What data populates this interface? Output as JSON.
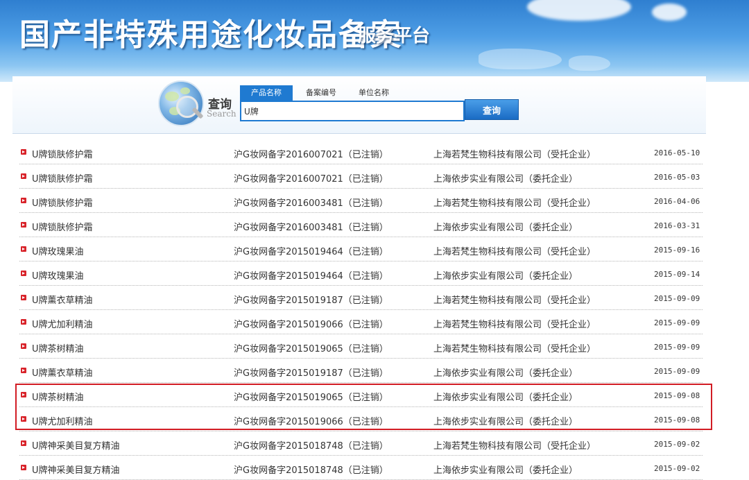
{
  "header": {
    "title": "国产非特殊用途化妆品备案",
    "subtitle": "服务平台"
  },
  "search": {
    "label_cn": "查询",
    "label_en": "Search",
    "tabs": [
      {
        "label": "产品名称",
        "active": true
      },
      {
        "label": "备案编号",
        "active": false
      },
      {
        "label": "单位名称",
        "active": false
      }
    ],
    "input_value": "U牌",
    "button_label": "查询"
  },
  "results": [
    {
      "name": "U牌锁肤修护霜",
      "record_no": "沪G妆网备字2016007021（已注销）",
      "company": "上海若梵生物科技有限公司（受托企业）",
      "date": "2016-05-10"
    },
    {
      "name": "U牌锁肤修护霜",
      "record_no": "沪G妆网备字2016007021（已注销）",
      "company": "上海依步实业有限公司（委托企业）",
      "date": "2016-05-03"
    },
    {
      "name": "U牌锁肤修护霜",
      "record_no": "沪G妆网备字2016003481（已注销）",
      "company": "上海若梵生物科技有限公司（受托企业）",
      "date": "2016-04-06"
    },
    {
      "name": "U牌锁肤修护霜",
      "record_no": "沪G妆网备字2016003481（已注销）",
      "company": "上海依步实业有限公司（委托企业）",
      "date": "2016-03-31"
    },
    {
      "name": "U牌玫瑰果油",
      "record_no": "沪G妆网备字2015019464（已注销）",
      "company": "上海若梵生物科技有限公司（受托企业）",
      "date": "2015-09-16"
    },
    {
      "name": "U牌玫瑰果油",
      "record_no": "沪G妆网备字2015019464（已注销）",
      "company": "上海依步实业有限公司（委托企业）",
      "date": "2015-09-14"
    },
    {
      "name": "U牌薰衣草精油",
      "record_no": "沪G妆网备字2015019187（已注销）",
      "company": "上海若梵生物科技有限公司（受托企业）",
      "date": "2015-09-09"
    },
    {
      "name": "U牌尤加利精油",
      "record_no": "沪G妆网备字2015019066（已注销）",
      "company": "上海若梵生物科技有限公司（受托企业）",
      "date": "2015-09-09"
    },
    {
      "name": "U牌茶树精油",
      "record_no": "沪G妆网备字2015019065（已注销）",
      "company": "上海若梵生物科技有限公司（受托企业）",
      "date": "2015-09-09"
    },
    {
      "name": "U牌薰衣草精油",
      "record_no": "沪G妆网备字2015019187（已注销）",
      "company": "上海依步实业有限公司（委托企业）",
      "date": "2015-09-09"
    },
    {
      "name": "U牌茶树精油",
      "record_no": "沪G妆网备字2015019065（已注销）",
      "company": "上海依步实业有限公司（委托企业）",
      "date": "2015-09-08"
    },
    {
      "name": "U牌尤加利精油",
      "record_no": "沪G妆网备字2015019066（已注销）",
      "company": "上海依步实业有限公司（委托企业）",
      "date": "2015-09-08"
    },
    {
      "name": "U牌神采美目复方精油",
      "record_no": "沪G妆网备字2015018748（已注销）",
      "company": "上海若梵生物科技有限公司（受托企业）",
      "date": "2015-09-02"
    },
    {
      "name": "U牌神采美目复方精油",
      "record_no": "沪G妆网备字2015018748（已注销）",
      "company": "上海依步实业有限公司（委托企业）",
      "date": "2015-09-02"
    }
  ],
  "colors": {
    "accent": "#1f7ad1",
    "highlight_border": "#d21c24",
    "bullet": "#d8232a"
  }
}
